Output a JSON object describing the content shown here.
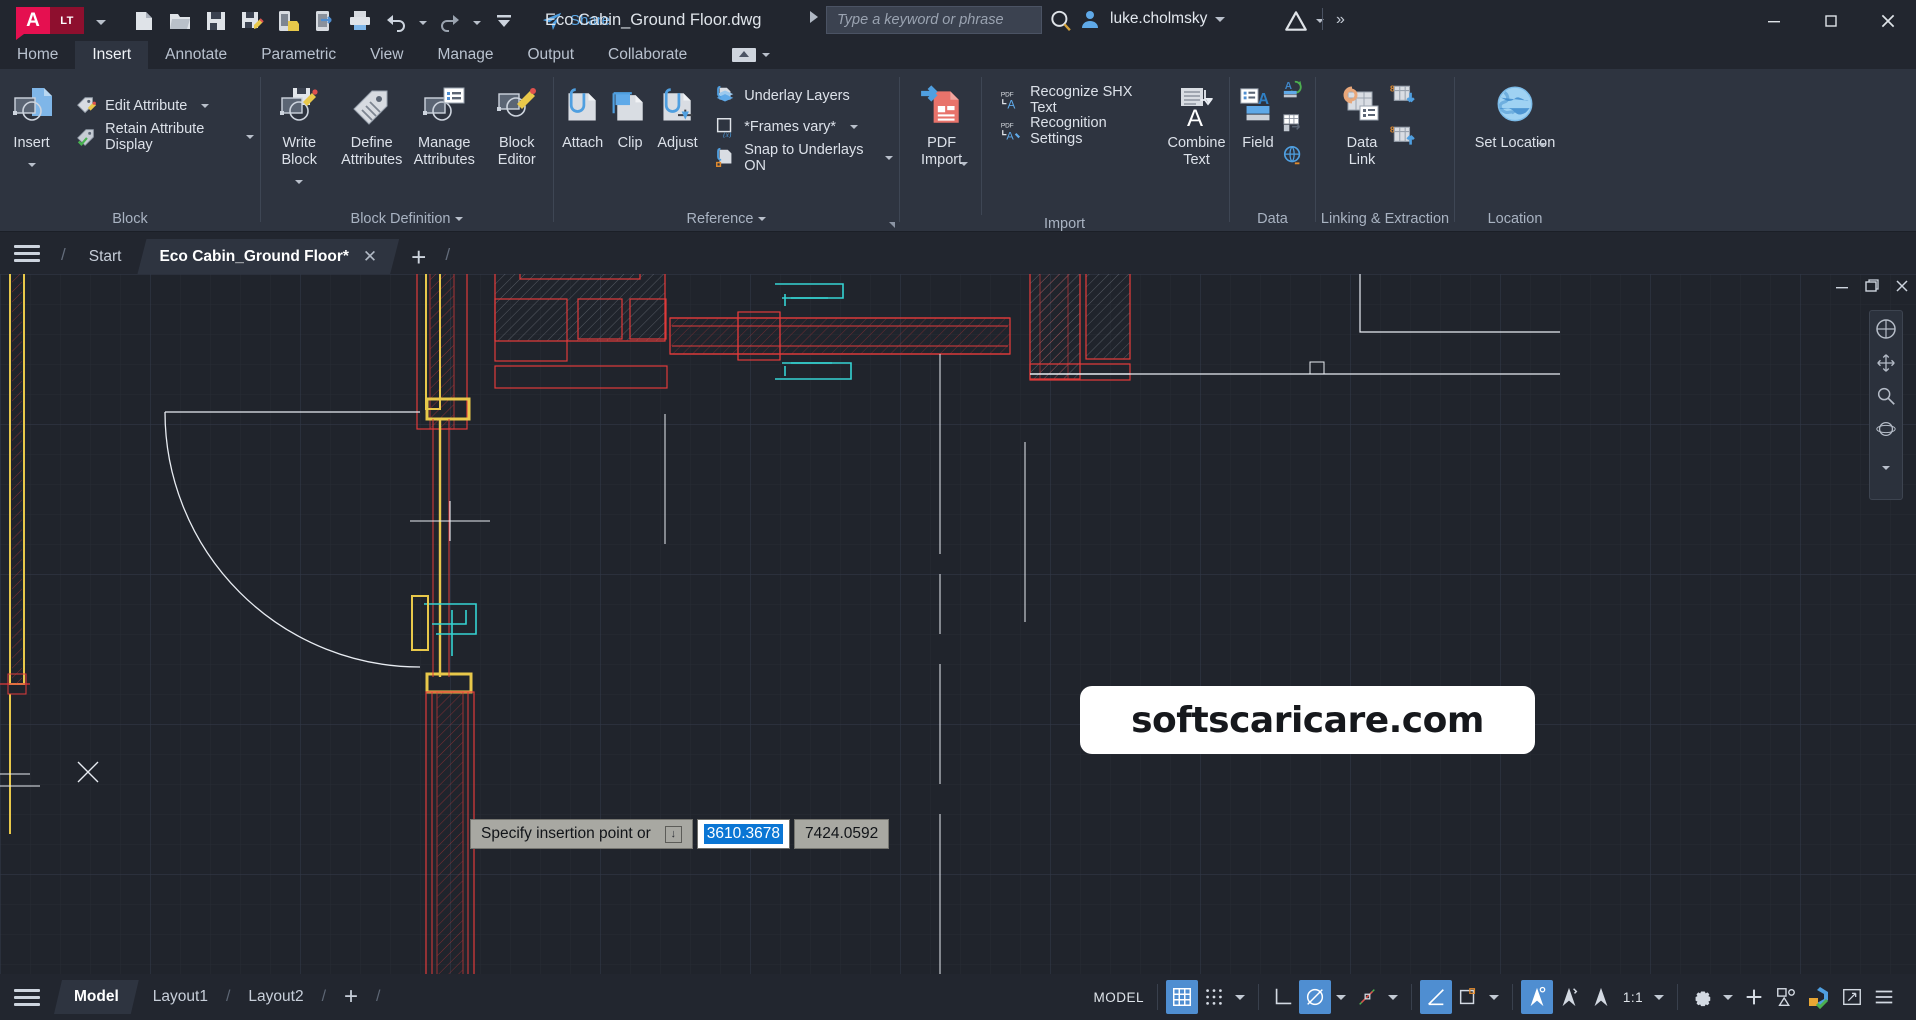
{
  "app": {
    "brand": "A",
    "brand_suffix": "LT",
    "document_title": "Eco Cabin_Ground Floor.dwg",
    "user_name": "luke.cholmsky"
  },
  "quick_access": [
    {
      "name": "new-icon",
      "tip": "New"
    },
    {
      "name": "open-icon",
      "tip": "Open"
    },
    {
      "name": "save-icon",
      "tip": "Save"
    },
    {
      "name": "save-as-icon",
      "tip": "Save As"
    },
    {
      "name": "save-to-web-icon",
      "tip": "Save to Web & Mobile"
    },
    {
      "name": "open-from-web-icon",
      "tip": "Open from Web & Mobile"
    },
    {
      "name": "plot-icon",
      "tip": "Plot"
    },
    {
      "name": "undo-icon",
      "tip": "Undo"
    },
    {
      "name": "redo-icon",
      "tip": "Redo"
    },
    {
      "name": "customize-icon",
      "tip": "Customize Quick Access Toolbar"
    }
  ],
  "share": {
    "label": "Share"
  },
  "search": {
    "placeholder": "Type a keyword or phrase"
  },
  "window_controls": {
    "minimize": "—",
    "maximize": "☐",
    "close": "✕"
  },
  "ribbon": {
    "tabs": [
      {
        "label": "Home",
        "active": false
      },
      {
        "label": "Insert",
        "active": true
      },
      {
        "label": "Annotate",
        "active": false
      },
      {
        "label": "Parametric",
        "active": false
      },
      {
        "label": "View",
        "active": false
      },
      {
        "label": "Manage",
        "active": false
      },
      {
        "label": "Output",
        "active": false
      },
      {
        "label": "Collaborate",
        "active": false
      }
    ],
    "panels": [
      {
        "label": "Block",
        "big": [
          {
            "label": "Insert",
            "dropdown": true,
            "icon": "insert-block-icon"
          }
        ],
        "rows": [
          {
            "label": "Edit Attribute",
            "dropdown": true,
            "icon": "edit-attribute-icon"
          },
          {
            "label": "Retain Attribute Display",
            "dropdown": true,
            "icon": "retain-attribute-display-icon"
          }
        ]
      },
      {
        "label": "Block Definition",
        "label_dropdown": true,
        "big": [
          {
            "label": "Write Block",
            "dropdown": true,
            "icon": "write-block-icon"
          },
          {
            "label": "Define Attributes",
            "dropdown": false,
            "icon": "define-attributes-icon"
          },
          {
            "label": "Manage Attributes",
            "dropdown": false,
            "icon": "manage-attributes-icon"
          },
          {
            "label": "Block Editor",
            "dropdown": false,
            "icon": "block-editor-icon"
          }
        ],
        "rows": []
      },
      {
        "label": "Reference",
        "label_dropdown": true,
        "expand": true,
        "big": [
          {
            "label": "Attach",
            "dropdown": false,
            "icon": "attach-icon"
          },
          {
            "label": "Clip",
            "dropdown": false,
            "icon": "clip-icon"
          },
          {
            "label": "Adjust",
            "dropdown": false,
            "icon": "adjust-icon"
          }
        ],
        "rows": [
          {
            "label": "Underlay Layers",
            "dropdown": false,
            "icon": "underlay-layers-icon"
          },
          {
            "label": "*Frames vary*",
            "dropdown": true,
            "icon": "frames-vary-icon"
          },
          {
            "label": "Snap to Underlays ON",
            "dropdown": true,
            "icon": "snap-to-underlays-icon"
          }
        ]
      },
      {
        "label": "Import",
        "big": [
          {
            "label": "PDF Import",
            "dropdown": true,
            "icon": "pdf-import-icon"
          }
        ],
        "rows": [
          {
            "label": "Recognize SHX Text",
            "dropdown": false,
            "icon": "recognize-shx-text-icon"
          },
          {
            "label": "Recognition Settings",
            "dropdown": false,
            "icon": "recognition-settings-icon"
          }
        ],
        "big2": [
          {
            "label": "Combine Text",
            "dropdown": false,
            "icon": "combine-text-icon"
          }
        ]
      },
      {
        "label": "Data",
        "big": [
          {
            "label": "Field",
            "dropdown": false,
            "icon": "field-icon"
          }
        ],
        "mini": [
          {
            "name": "update-field-icon"
          },
          {
            "name": "table-link-icon"
          },
          {
            "name": "hyperlink-icon"
          }
        ]
      },
      {
        "label": "Linking & Extraction",
        "big": [
          {
            "label": "Data Link",
            "dropdown": false,
            "icon": "data-link-icon"
          }
        ],
        "mini": [
          {
            "name": "download-from-source-icon"
          },
          {
            "name": "upload-to-source-icon"
          }
        ]
      },
      {
        "label": "Location",
        "big": [
          {
            "label": "Set Location",
            "dropdown": true,
            "icon": "set-location-icon"
          }
        ]
      }
    ]
  },
  "doc_tabs": {
    "menu_icon": "application-menu-icon",
    "tabs": [
      {
        "label": "Start",
        "active": false,
        "closable": false
      },
      {
        "label": "Eco Cabin_Ground Floor*",
        "active": true,
        "closable": true
      }
    ],
    "new_tab": "+"
  },
  "dynamic_input": {
    "prompt": "Specify insertion point or",
    "x_value": "3610.3678",
    "y_value": "7424.0592",
    "dropdown_glyph": "↓"
  },
  "watermark": {
    "text": "softscaricare.com"
  },
  "viewport": {
    "minimize": "—",
    "restore": "❐",
    "close": "✕"
  },
  "status_bar": {
    "layout_menu_icon": "layout-menu-icon",
    "layouts": [
      {
        "label": "Model",
        "active": true
      },
      {
        "label": "Layout1",
        "active": false
      },
      {
        "label": "Layout2",
        "active": false
      }
    ],
    "add_layout": "+",
    "space_label": "MODEL",
    "toggles": [
      {
        "name": "grid-display-toggle",
        "label": "",
        "on": true
      },
      {
        "name": "snap-mode-toggle",
        "label": "",
        "on": false
      },
      {
        "name": "ortho-mode-toggle",
        "label": "",
        "on": false
      },
      {
        "name": "polar-tracking-toggle",
        "label": "",
        "on": true
      },
      {
        "name": "object-snap-toggle",
        "label": "",
        "on": false
      },
      {
        "name": "isometric-drafting-toggle",
        "label": "",
        "on": false
      },
      {
        "name": "object-snap-tracking-toggle",
        "label": "",
        "on": true
      },
      {
        "name": "lineweight-toggle",
        "label": "",
        "on": false
      },
      {
        "name": "transparency-toggle",
        "label": "",
        "on": false
      },
      {
        "name": "annotation-visibility-toggle",
        "label": "",
        "on": true
      },
      {
        "name": "autoscale-toggle",
        "label": "",
        "on": false
      },
      {
        "name": "annotation-scale-toggle",
        "label": "",
        "on": false
      }
    ],
    "annotation_scale": "1:1",
    "workspace_icon": "workspace-switching-icon",
    "hardware_accel_icon": "hardware-acceleration-icon",
    "isolate_objects_icon": "isolate-objects-icon",
    "clean_screen_icon": "clean-screen-icon",
    "customization_icon": "customization-icon"
  },
  "colors": {
    "brand_red": "#e51050",
    "accent_blue": "#4f8ed1",
    "canvas_bg": "#20242c",
    "ribbon_bg": "#2e3440",
    "chrome_bg": "#22262f",
    "text": "#d6dbe3",
    "selection_blue": "#0b76d4",
    "drawing_red": "#e03b3b",
    "drawing_cyan": "#35d3d3",
    "drawing_yellow": "#e8c84a",
    "drawing_white": "#e8ecf2"
  }
}
